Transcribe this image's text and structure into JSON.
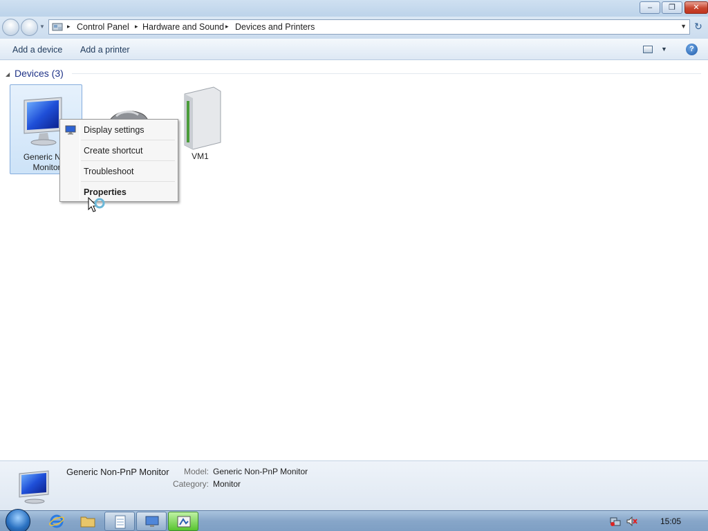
{
  "window": {
    "buttons": {
      "minimize": "–",
      "maximize": "❐",
      "close": "✕"
    }
  },
  "address_bar": {
    "crumbs": [
      "Control Panel",
      "Hardware and Sound",
      "Devices and Printers"
    ],
    "separator": "▸",
    "icon": "control-panel-icon"
  },
  "toolbar": {
    "add_device": "Add a device",
    "add_printer": "Add a printer",
    "help": "?"
  },
  "group": {
    "toggle": "◢",
    "title": "Devices (3)"
  },
  "devices": [
    {
      "label": "Generic Non-PnP Monitor",
      "label_visible": "Generic Non\nMonitor",
      "icon": "monitor-icon",
      "selected": true
    },
    {
      "label": "",
      "icon": "mouse-icon",
      "selected": false
    },
    {
      "label": "VM1",
      "icon": "computer-tower-icon",
      "selected": false
    }
  ],
  "context_menu": {
    "items": [
      {
        "label": "Display settings",
        "icon": "display-settings-icon",
        "bold": false
      },
      {
        "label": "Create shortcut",
        "bold": false
      },
      {
        "label": "Troubleshoot",
        "bold": false
      },
      {
        "label": "Properties",
        "bold": true
      }
    ]
  },
  "details": {
    "name": "Generic Non-PnP Monitor",
    "model_label": "Model:",
    "model_value": "Generic Non-PnP Monitor",
    "category_label": "Category:",
    "category_value": "Monitor"
  },
  "taskbar": {
    "clock": "15:05",
    "pinned": [
      "internet-explorer-icon",
      "folder-icon",
      "notepad-icon",
      "display-icon",
      "control-panel-icon"
    ]
  }
}
